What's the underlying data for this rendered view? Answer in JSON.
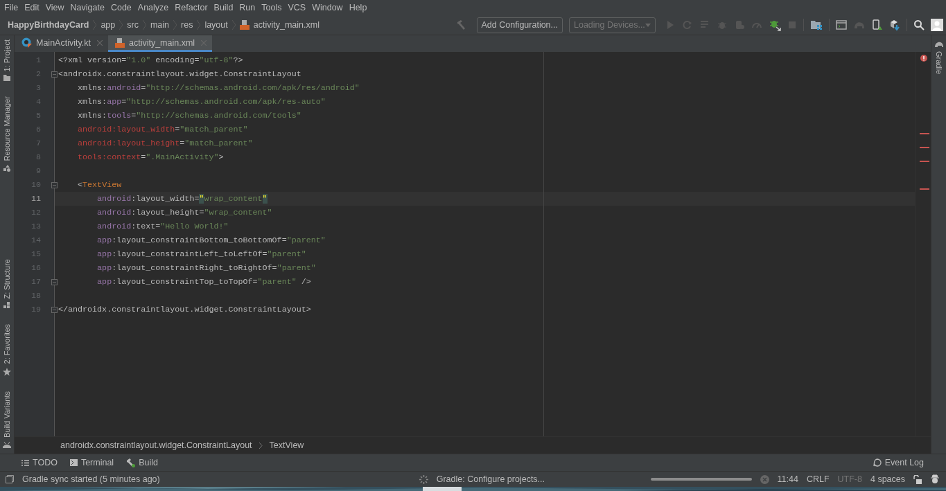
{
  "menu": [
    "File",
    "Edit",
    "View",
    "Navigate",
    "Code",
    "Analyze",
    "Refactor",
    "Build",
    "Run",
    "Tools",
    "VCS",
    "Window",
    "Help"
  ],
  "breadcrumbs": [
    {
      "label": "HappyBirthdayCard",
      "kind": "project"
    },
    {
      "label": "app",
      "kind": "folder"
    },
    {
      "label": "src",
      "kind": "folder"
    },
    {
      "label": "main",
      "kind": "folder"
    },
    {
      "label": "res",
      "kind": "folder"
    },
    {
      "label": "layout",
      "kind": "folder"
    },
    {
      "label": "activity_main.xml",
      "kind": "xml"
    }
  ],
  "toolbar": {
    "configuration_button": "Add Configuration...",
    "device_dropdown": "Loading Devices..."
  },
  "editor_tabs": [
    {
      "label": "MainActivity.kt",
      "kind": "kotlin",
      "selected": false
    },
    {
      "label": "activity_main.xml",
      "kind": "xml",
      "selected": true
    }
  ],
  "left_tool_windows_top": [
    {
      "label": "1: Project",
      "kind": "folder"
    },
    {
      "label": "Resource Manager",
      "kind": "resources"
    }
  ],
  "left_tool_windows_bottom": [
    {
      "label": "Z: Structure",
      "kind": "structure"
    },
    {
      "label": "2: Favorites",
      "kind": "star"
    },
    {
      "label": "Build Variants",
      "kind": "android"
    }
  ],
  "right_tool_windows": [
    {
      "label": "Gradle"
    }
  ],
  "code_lines": [
    {
      "number": "1",
      "current": false,
      "fold": false,
      "tokens": [
        {
          "kind": "plain",
          "text": "<?xml version="
        },
        {
          "kind": "value",
          "text": "\"1.0\""
        },
        {
          "kind": "plain",
          "text": " encoding="
        },
        {
          "kind": "value",
          "text": "\"utf-8\""
        },
        {
          "kind": "plain",
          "text": "?>"
        }
      ]
    },
    {
      "number": "2",
      "current": false,
      "fold": true,
      "tokens": [
        {
          "kind": "plain",
          "text": "<androidx.constraintlayout.widget.ConstraintLayout"
        }
      ]
    },
    {
      "number": "3",
      "current": false,
      "fold": false,
      "tokens": [
        {
          "kind": "plain",
          "text": "    xmlns:"
        },
        {
          "kind": "ns",
          "text": "android"
        },
        {
          "kind": "plain",
          "text": "="
        },
        {
          "kind": "value",
          "text": "\"http://schemas.android.com/apk/res/android\""
        }
      ]
    },
    {
      "number": "4",
      "current": false,
      "fold": false,
      "tokens": [
        {
          "kind": "plain",
          "text": "    xmlns:"
        },
        {
          "kind": "ns",
          "text": "app"
        },
        {
          "kind": "plain",
          "text": "="
        },
        {
          "kind": "value",
          "text": "\"http://schemas.android.com/apk/res-auto\""
        }
      ]
    },
    {
      "number": "5",
      "current": false,
      "fold": false,
      "tokens": [
        {
          "kind": "plain",
          "text": "    xmlns:"
        },
        {
          "kind": "ns",
          "text": "tools"
        },
        {
          "kind": "plain",
          "text": "="
        },
        {
          "kind": "value",
          "text": "\"http://schemas.android.com/tools\""
        }
      ]
    },
    {
      "number": "6",
      "current": false,
      "fold": false,
      "tokens": [
        {
          "kind": "error",
          "text": "    android:layout_width"
        },
        {
          "kind": "plain",
          "text": "="
        },
        {
          "kind": "value",
          "text": "\"match_parent\""
        }
      ]
    },
    {
      "number": "7",
      "current": false,
      "fold": false,
      "tokens": [
        {
          "kind": "error",
          "text": "    android:layout_height"
        },
        {
          "kind": "plain",
          "text": "="
        },
        {
          "kind": "value",
          "text": "\"match_parent\""
        }
      ]
    },
    {
      "number": "8",
      "current": false,
      "fold": false,
      "tokens": [
        {
          "kind": "error",
          "text": "    tools:context"
        },
        {
          "kind": "plain",
          "text": "="
        },
        {
          "kind": "value",
          "text": "\".MainActivity\""
        },
        {
          "kind": "plain",
          "text": ">"
        }
      ]
    },
    {
      "number": "9",
      "current": false,
      "fold": false
    },
    {
      "number": "10",
      "current": false,
      "fold": true,
      "tokens": [
        {
          "kind": "plain",
          "text": "    <"
        },
        {
          "kind": "tag",
          "text": "TextView"
        }
      ]
    },
    {
      "number": "11",
      "current": true,
      "fold": false,
      "tokens": [
        {
          "kind": "ns",
          "text": "        android"
        },
        {
          "kind": "plain",
          "text": ":layout_width="
        },
        {
          "kind": "match",
          "text": "\""
        },
        {
          "kind": "value",
          "text": "wrap_content"
        },
        {
          "kind": "match",
          "text": "\""
        }
      ]
    },
    {
      "number": "12",
      "current": false,
      "fold": false,
      "tokens": [
        {
          "kind": "ns",
          "text": "        android"
        },
        {
          "kind": "plain",
          "text": ":layout_height="
        },
        {
          "kind": "value",
          "text": "\"wrap_content\""
        }
      ]
    },
    {
      "number": "13",
      "current": false,
      "fold": false,
      "tokens": [
        {
          "kind": "ns",
          "text": "        android"
        },
        {
          "kind": "plain",
          "text": ":text="
        },
        {
          "kind": "value",
          "text": "\"Hello World!\""
        }
      ]
    },
    {
      "number": "14",
      "current": false,
      "fold": false,
      "tokens": [
        {
          "kind": "ns",
          "text": "        app"
        },
        {
          "kind": "plain",
          "text": ":layout_constraintBottom_toBottomOf="
        },
        {
          "kind": "value",
          "text": "\"parent\""
        }
      ]
    },
    {
      "number": "15",
      "current": false,
      "fold": false,
      "tokens": [
        {
          "kind": "ns",
          "text": "        app"
        },
        {
          "kind": "plain",
          "text": ":layout_constraintLeft_toLeftOf="
        },
        {
          "kind": "value",
          "text": "\"parent\""
        }
      ]
    },
    {
      "number": "16",
      "current": false,
      "fold": false,
      "tokens": [
        {
          "kind": "ns",
          "text": "        app"
        },
        {
          "kind": "plain",
          "text": ":layout_constraintRight_toRightOf="
        },
        {
          "kind": "value",
          "text": "\"parent\""
        }
      ]
    },
    {
      "number": "17",
      "current": false,
      "fold": true,
      "tokens": [
        {
          "kind": "ns",
          "text": "        app"
        },
        {
          "kind": "plain",
          "text": ":layout_constraintTop_toTopOf="
        },
        {
          "kind": "value",
          "text": "\"parent\""
        },
        {
          "kind": "plain",
          "text": " />"
        }
      ]
    },
    {
      "number": "18",
      "current": false,
      "fold": false
    },
    {
      "number": "19",
      "current": false,
      "fold": true,
      "tokens": [
        {
          "kind": "plain",
          "text": "</androidx.constraintlayout.widget.ConstraintLayout>"
        }
      ]
    }
  ],
  "breadcrumb_path": [
    "androidx.constraintlayout.widget.ConstraintLayout",
    "TextView"
  ],
  "tool_windows": [
    {
      "label": "TODO",
      "kind": "todo"
    },
    {
      "label": "Terminal",
      "kind": "terminal"
    },
    {
      "label": "Build",
      "kind": "build"
    }
  ],
  "event_log": "Event Log",
  "status": {
    "message": "Gradle sync started (5 minutes ago)",
    "progress_task": "Gradle: Configure projects...",
    "position": "11:44",
    "line_separator": "CRLF",
    "encoding": "UTF-8",
    "indent": "4 spaces"
  }
}
